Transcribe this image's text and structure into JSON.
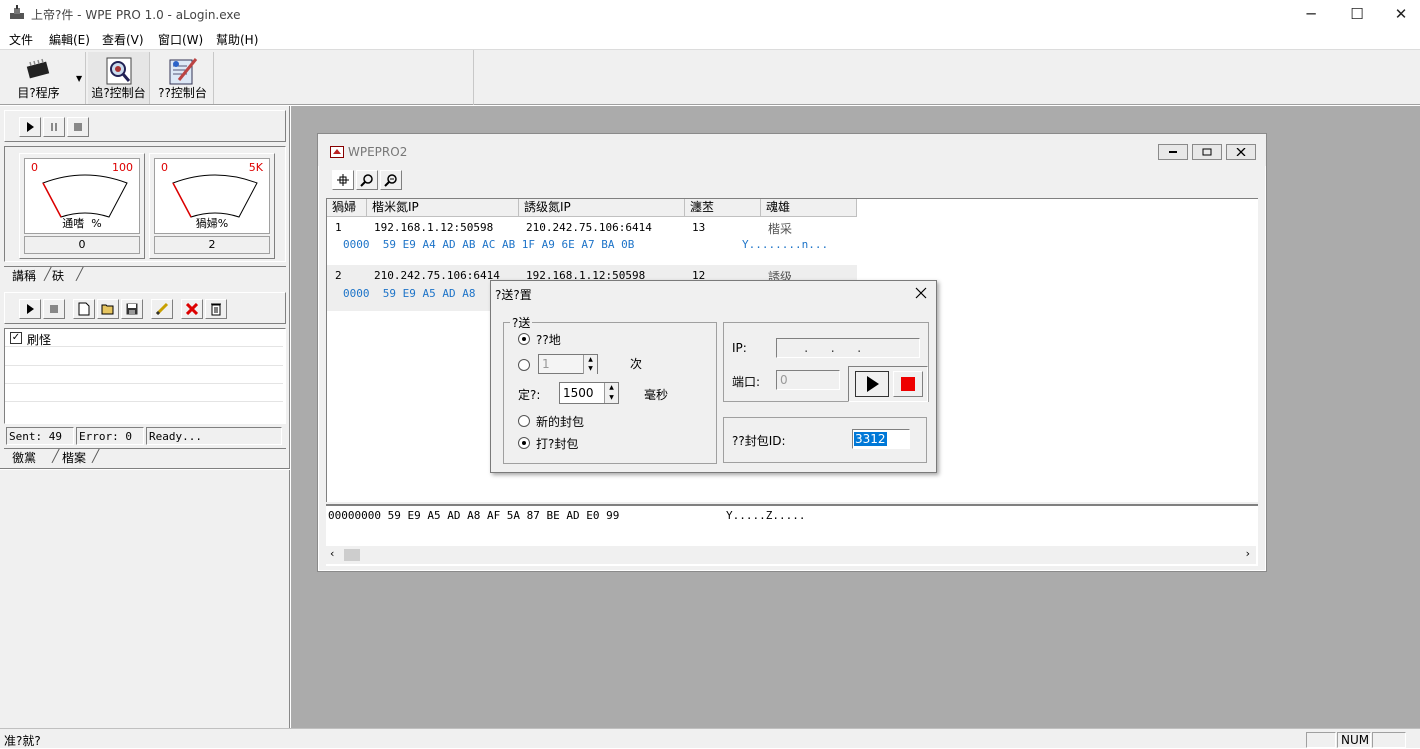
{
  "window": {
    "title": "上帝?件 - WPE PRO 1.0 - aLogin.exe",
    "minimize_glyph": "─",
    "maximize_glyph": "☐",
    "close_glyph": "✕"
  },
  "menu": [
    "文件",
    "編輯(E)",
    "查看(V)",
    "窗口(W)",
    "幫助(H)"
  ],
  "toolbar": {
    "target_program": "目?程序",
    "trace_console": "追?控制台",
    "filter_console": "??控制台"
  },
  "left_panel": {
    "gauge1": {
      "min": "0",
      "max": "100",
      "label": "通嗜  %",
      "value": "0"
    },
    "gauge2": {
      "min": "0",
      "max": "5K",
      "label": "猧婦%",
      "value": "2"
    },
    "tabs1": [
      "講稱",
      "砆"
    ],
    "list_item": "刷怪",
    "status": {
      "sent": "Sent: 49",
      "error": "Error: 0",
      "state": "Ready..."
    },
    "tabs2": [
      "徼黨",
      "楷案"
    ]
  },
  "child_window": {
    "title": "WPEPRO2",
    "columns": [
      "猧婦",
      "楷米氮IP",
      "誘级氮IP",
      "瀍苤",
      "魂雄"
    ],
    "rows": [
      {
        "no": "1",
        "src": "192.168.1.12:50598",
        "dst": "210.242.75.106:6414",
        "len": "13",
        "dir": "楷采",
        "hex": "0000  59 E9 A4 AD AB AC AB 1F A9 6E A7 BA 0B",
        "ascii": "Y........n..."
      },
      {
        "no": "2",
        "src": "210.242.75.106:6414",
        "dst": "192.168.1.12:50598",
        "len": "12",
        "dir": "誘级",
        "hex": "0000  59 E9 A5 AD A8",
        "ascii": ""
      }
    ],
    "hex_line": "00000000 59 E9 A5 AD A8 AF 5A 87 BE AD E0 99",
    "hex_ascii": "Y.....Z....."
  },
  "dialog": {
    "title": "?送?置",
    "group_label": "?送",
    "radio_infinite": "??地",
    "count_value": "1",
    "count_unit": "次",
    "interval_label": "定?:",
    "interval_value": "1500",
    "interval_unit": "毫秒",
    "radio_new_packet": "新的封包",
    "radio_hit_packet": "打?封包",
    "ip_label": "IP:",
    "ip_value": "   .   .   .",
    "port_label": "端口:",
    "port_value": "0",
    "packet_id_label": "??封包ID:",
    "packet_id_value": "3312"
  },
  "statusbar": {
    "text": "准?就?",
    "num": "NUM"
  }
}
